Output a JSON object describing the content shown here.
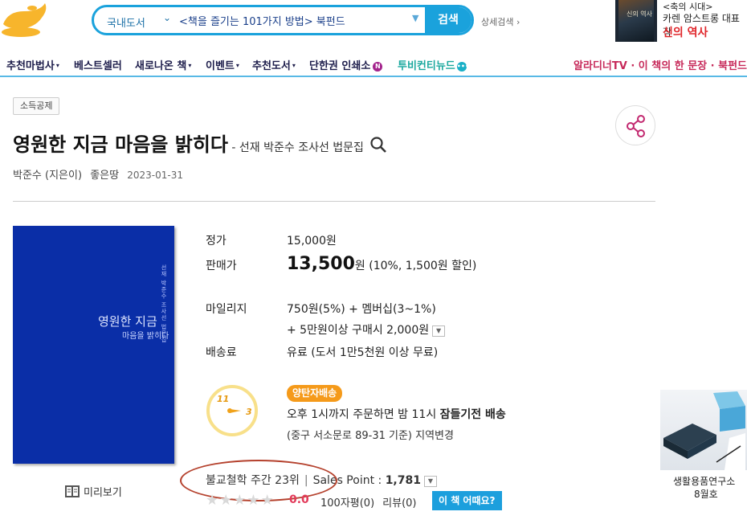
{
  "header": {
    "search": {
      "category": "국내도서",
      "query": "<책을 즐기는 101가지 방법> 북펀드",
      "button_label": "검색"
    },
    "detail_search": "상세검색 ›",
    "ad": {
      "line1": "<축의 시대>",
      "line2": "카렌 암스트롱 대표작",
      "line3": "신의 역사",
      "book_text": "신의 역사"
    }
  },
  "nav": {
    "items": [
      {
        "label": "추천마법사",
        "caret": "▾"
      },
      {
        "label": "베스트셀러",
        "caret": ""
      },
      {
        "label": "새로나온 책",
        "caret": "▾"
      },
      {
        "label": "이벤트",
        "caret": "▾"
      },
      {
        "label": "추천도서",
        "caret": "▾"
      },
      {
        "label": "단한권 인쇄소",
        "caret": ""
      },
      {
        "label": "투비컨티뉴드",
        "caret": ""
      }
    ],
    "badge_n": "N",
    "badge_dot": "•••",
    "right": "알라디너TV · 이 책의 한 문장 · 북펀드"
  },
  "product": {
    "tag": "소득공제",
    "title": "영원한 지금 마음을 밝히다",
    "subtitle": " - 선재 박준수 조사선 법문집",
    "author": "박준수 (지은이)",
    "publisher": "좋은땅",
    "date": "2023-01-31",
    "cover": {
      "title": "영원한 지금",
      "subtitle": "마음을 밝히다",
      "vertical": "선재 박준수 조사선 법문집"
    },
    "preview_label": "미리보기"
  },
  "price": {
    "list_label": "정가",
    "list_value": "15,000원",
    "sale_label": "판매가",
    "sale_value": "13,500",
    "sale_unit": "원",
    "sale_discount": " (10%, 1,500원 할인)",
    "mileage_label": "마일리지",
    "mileage_value": "750원(5%) + 멤버십(3~1%)",
    "mileage_extra": "+ 5만원이상 구매시 2,000원",
    "shipping_label": "배송료",
    "shipping_value": "유료 (도서 1만5천원 이상 무료)"
  },
  "delivery": {
    "badge": "양탄자배송",
    "clock_11": "11",
    "clock_3": "3",
    "line1_pre": "오후 1시까지 주문하면 밤 11시 ",
    "line1_bold": "잠들기전 배송",
    "line2": "(중구 서소문로 89-31 기준) 지역변경"
  },
  "ranking": {
    "rank": "불교철학 주간 23위",
    "separator": "|",
    "sales_label": "Sales Point : ",
    "sales_value": "1,781"
  },
  "rating": {
    "stars": 0,
    "star_char": "★",
    "score": "0.0",
    "review100": "100자평(0)",
    "review": "리뷰(0)",
    "how_button": "이 책 어때요?"
  },
  "side_ad": {
    "line1": "생활용품연구소",
    "line2": "8월호"
  },
  "colors": {
    "accent": "#1aa2dc",
    "cover": "#0a2ea7",
    "price_red": "#e23a5a",
    "badge_orange": "#f59a1a"
  }
}
